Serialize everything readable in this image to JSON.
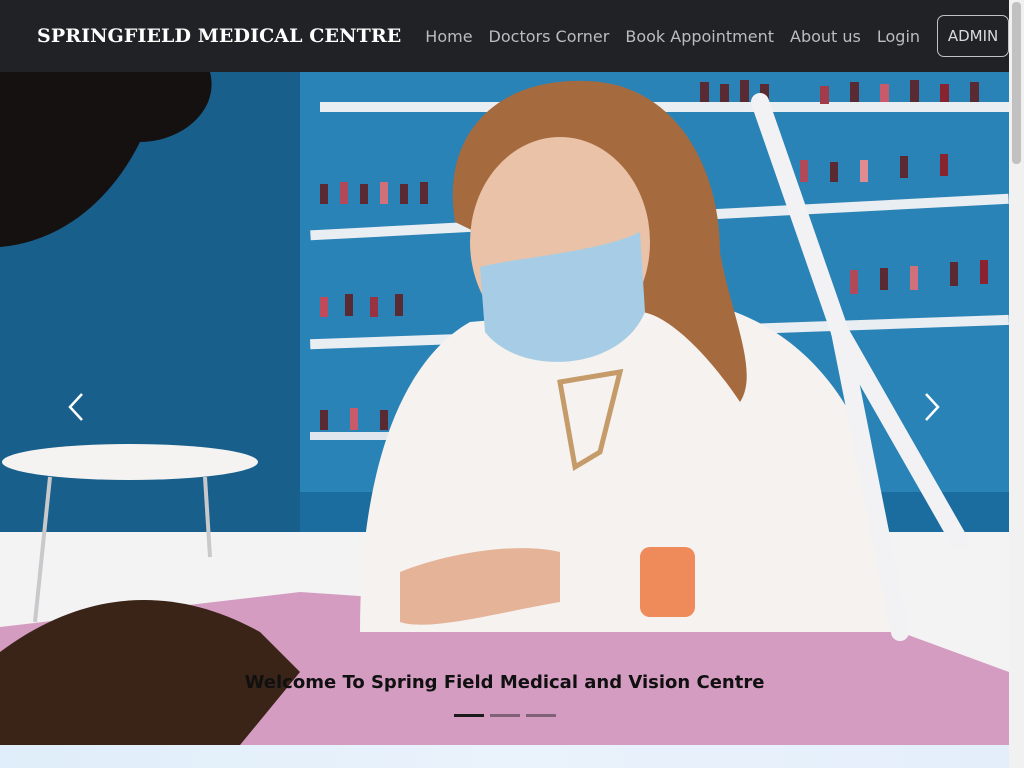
{
  "navbar": {
    "brand": "SPRINGFIELD MEDICAL CENTRE",
    "links": [
      {
        "label": "Home"
      },
      {
        "label": "Doctors Corner"
      },
      {
        "label": "Book Appointment"
      },
      {
        "label": "About us"
      },
      {
        "label": "Login"
      }
    ],
    "admin_button": "ADMIN"
  },
  "carousel": {
    "caption": "Welcome To Spring Field Medical and Vision Centre",
    "slide_count": 3,
    "active_slide": 1,
    "prev_icon": "chevron-left-icon",
    "next_icon": "chevron-right-icon"
  },
  "colors": {
    "navbar_bg": "#202226",
    "brand_text": "#ffffff",
    "nav_link": "#b9bcc1",
    "wall_blue": "#1a6fa0"
  }
}
